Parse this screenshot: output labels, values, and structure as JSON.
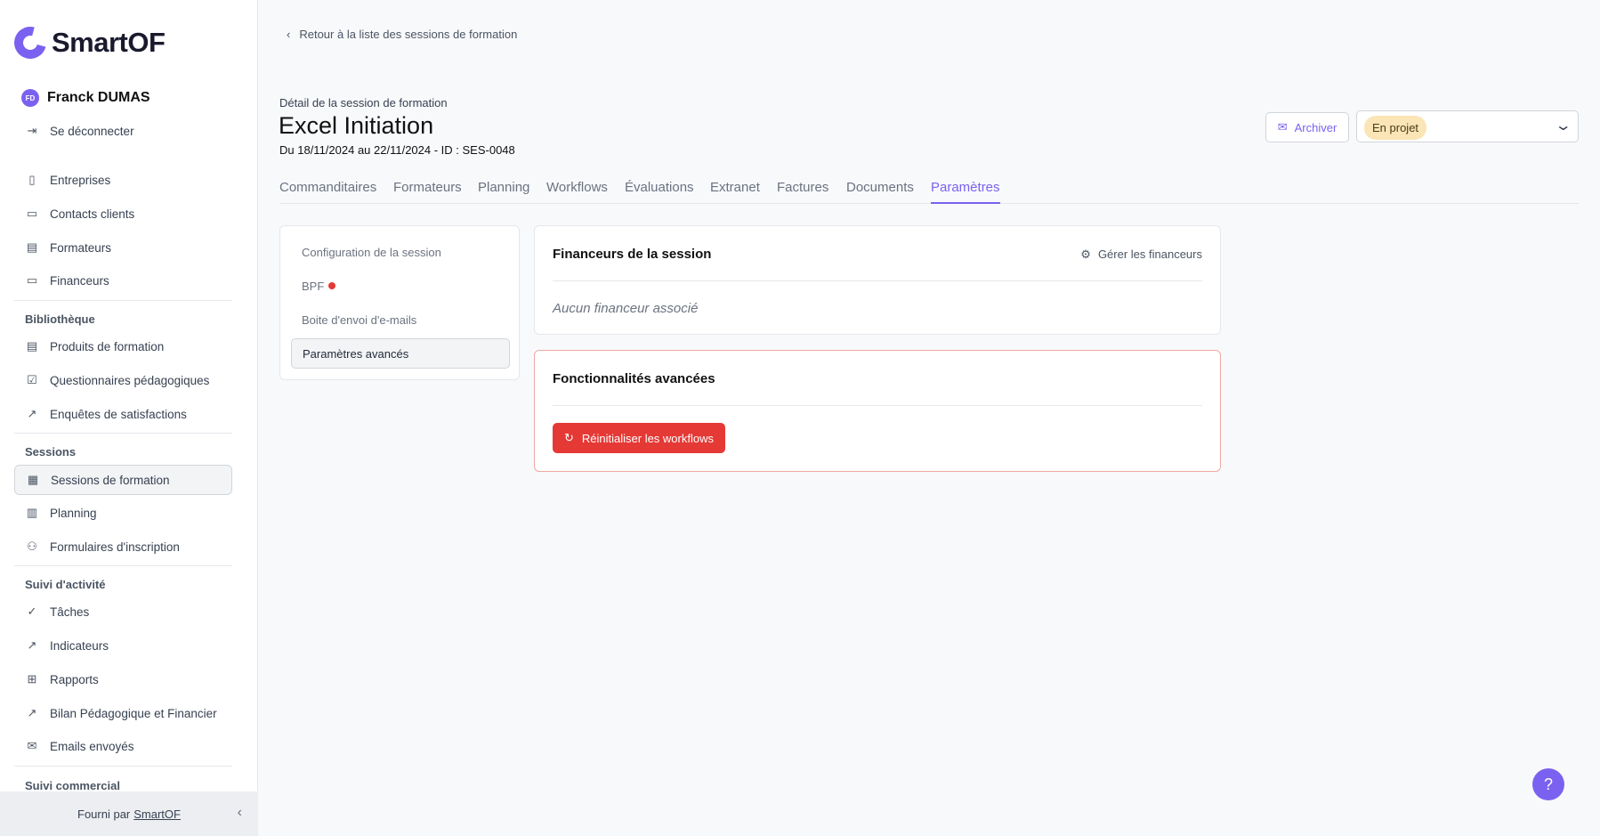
{
  "brand": {
    "name": "SmartOF",
    "accent": "#7b61f0"
  },
  "user": {
    "initials": "FD",
    "name": "Franck DUMAS",
    "logout": "Se déconnecter"
  },
  "nav": {
    "main": [
      "Entreprises",
      "Contacts clients",
      "Formateurs",
      "Financeurs"
    ],
    "library_title": "Bibliothèque",
    "library": [
      "Produits de formation",
      "Questionnaires pédagogiques",
      "Enquêtes de satisfactions"
    ],
    "sessions_title": "Sessions",
    "sessions": [
      "Sessions de formation",
      "Planning",
      "Formulaires d'inscription"
    ],
    "activity_title": "Suivi d'activité",
    "activity": [
      "Tâches",
      "Indicateurs",
      "Rapports",
      "Bilan Pédagogique et Financier",
      "Emails envoyés"
    ],
    "commercial_title": "Suivi commercial"
  },
  "footer": {
    "prefix": "Fourni par",
    "link": "SmartOF"
  },
  "header": {
    "back": "Retour à la liste des sessions de formation",
    "subtitle": "Détail de la session de formation",
    "title": "Excel Initiation",
    "dates": "Du 18/11/2024 au 22/11/2024 - ID : SES-0048",
    "archive": "Archiver",
    "status": "En projet"
  },
  "tabs": [
    "Commanditaires",
    "Formateurs",
    "Planning",
    "Workflows",
    "Évaluations",
    "Extranet",
    "Factures",
    "Documents",
    "Paramètres"
  ],
  "settings_menu": [
    "Configuration de la session",
    "BPF",
    "Boite d'envoi d'e-mails",
    "Paramètres avancés"
  ],
  "financeurs": {
    "title": "Financeurs de la session",
    "manage": "Gérer les financeurs",
    "empty": "Aucun financeur associé"
  },
  "advanced": {
    "title": "Fonctionnalités avancées",
    "reset": "Réinitialiser les workflows"
  },
  "help": "?"
}
